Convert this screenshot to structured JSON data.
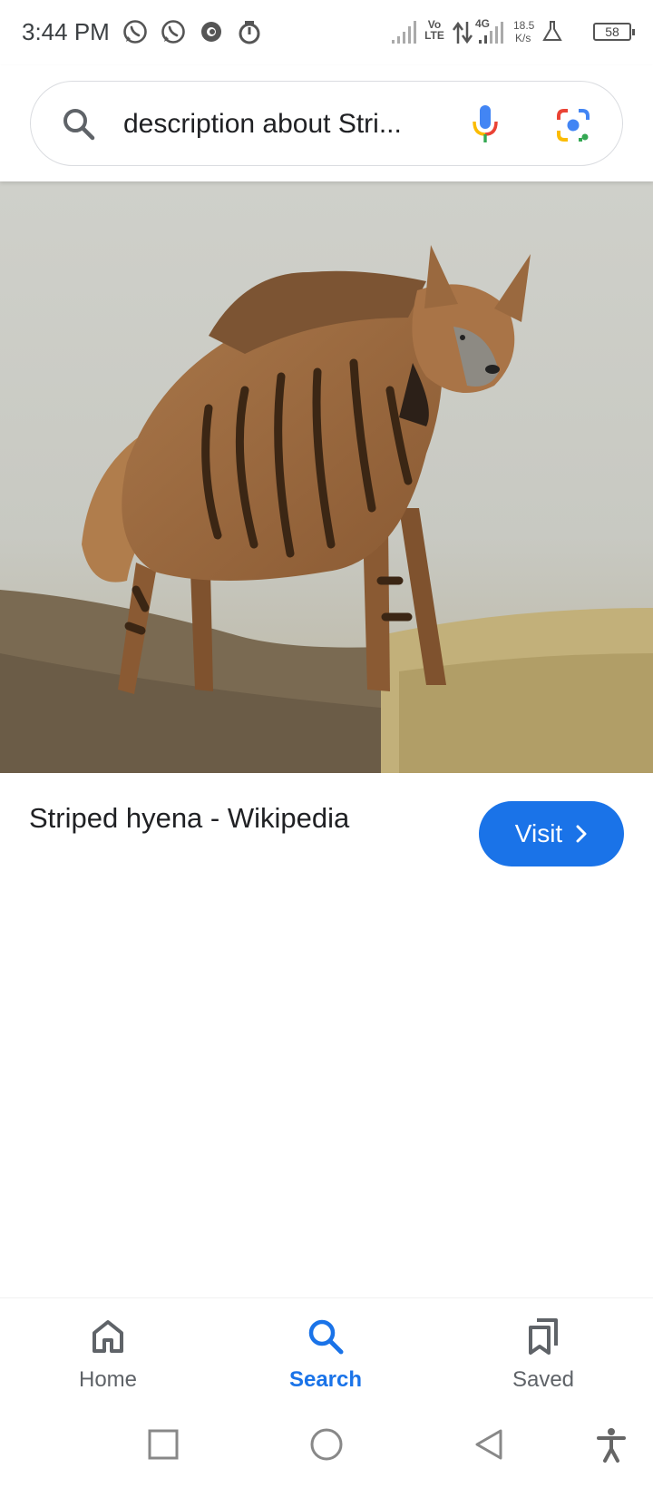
{
  "status_bar": {
    "time": "3:44 PM",
    "network_type": "Vo LTE",
    "network_gen": "4G",
    "speed_value": "18.5",
    "speed_unit": "K/s",
    "battery": "58",
    "icons": [
      "whatsapp-icon",
      "whatsapp-icon",
      "app-icon",
      "timer-icon",
      "signal-icon",
      "data-arrows-icon",
      "signal-icon",
      "flask-icon",
      "battery-icon"
    ]
  },
  "search": {
    "query": "description about Stri...",
    "icons": [
      "search-icon",
      "mic-icon",
      "lens-icon"
    ]
  },
  "result": {
    "image_subject": "Striped hyena",
    "title": "Striped hyena - Wikipedia",
    "visit_label": "Visit"
  },
  "bottom_nav": {
    "items": [
      {
        "label": "Home",
        "icon": "home-icon"
      },
      {
        "label": "Search",
        "icon": "search-icon",
        "active": true
      },
      {
        "label": "Saved",
        "icon": "bookmarks-icon"
      }
    ]
  },
  "system_nav": {
    "icons": [
      "recents-icon",
      "home-circle-icon",
      "back-icon",
      "accessibility-icon"
    ]
  },
  "colors": {
    "accent": "#1a73e8",
    "text": "#202124",
    "muted": "#5f6368",
    "border": "#dadce0"
  }
}
